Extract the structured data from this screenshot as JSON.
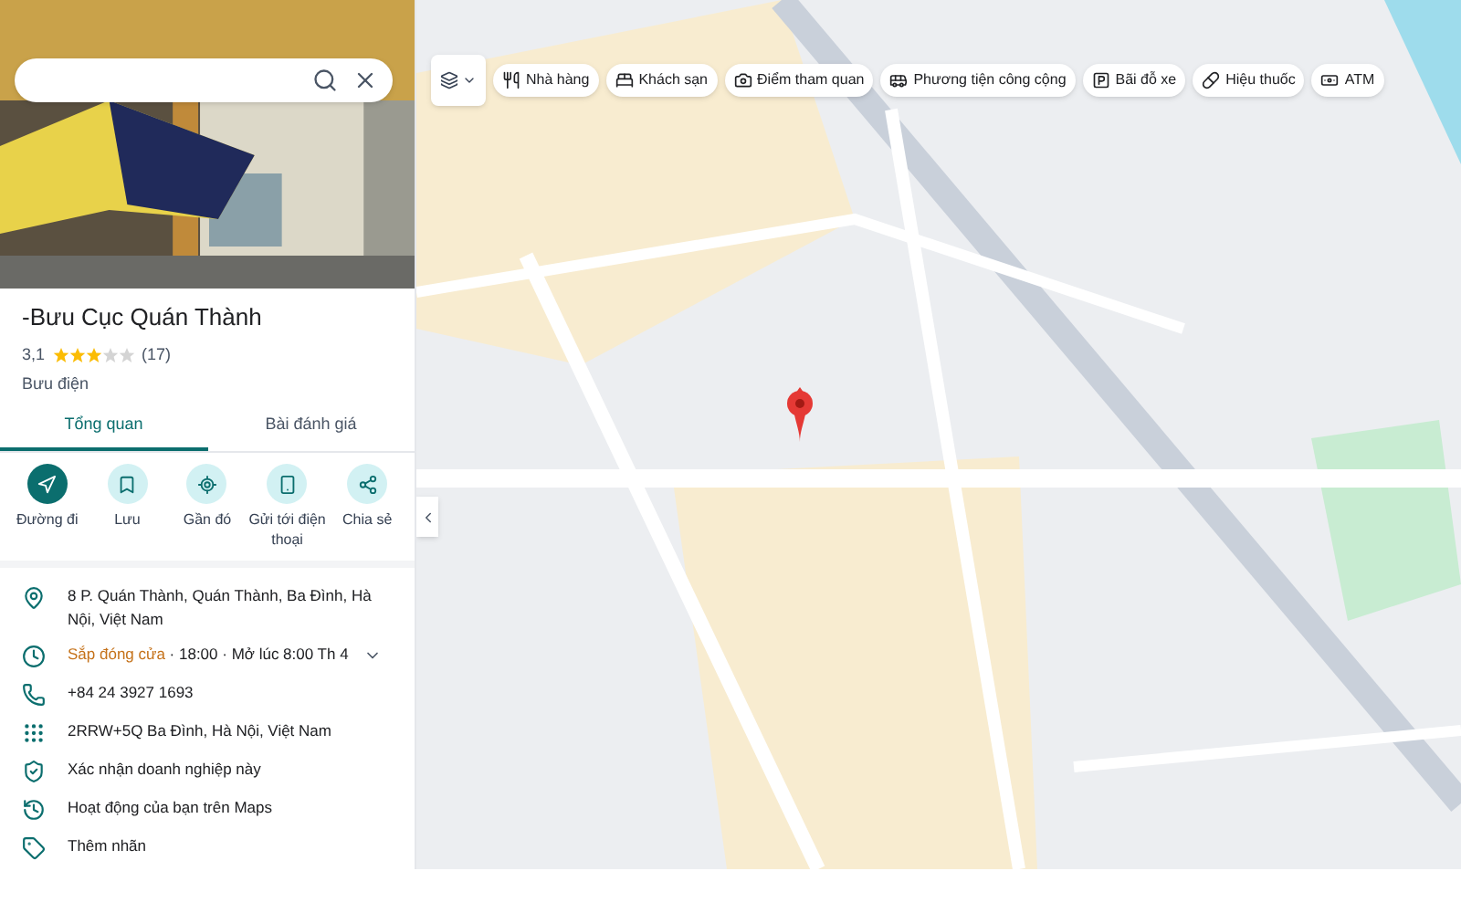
{
  "place": {
    "name": "-Bưu Cục Quán Thành",
    "rating": "3,1",
    "stars": 3,
    "reviews": "(17)",
    "category": "Bưu điện"
  },
  "tabs": [
    {
      "label": "Tổng quan",
      "selected": true
    },
    {
      "label": "Bài đánh giá",
      "selected": false
    }
  ],
  "actions": [
    {
      "label": "Đường đi",
      "kind": "primary"
    },
    {
      "label": "Lưu",
      "kind": "secondary"
    },
    {
      "label": "Gần đó",
      "kind": "secondary"
    },
    {
      "label": "Gửi tới điện thoại",
      "kind": "secondary"
    },
    {
      "label": "Chia sẻ",
      "kind": "secondary"
    }
  ],
  "details": [
    {
      "kind": "address",
      "text": "8 P. Quán Thành, Quán Thành, Ba Đình, Hà Nội, Việt Nam"
    },
    {
      "kind": "hours",
      "status": "Sắp đóng cửa",
      "text": " · 18:00 · Mở lúc 8:00 Th 4",
      "expanded": false
    },
    {
      "kind": "phone",
      "text": "+84 24 3927 1693"
    },
    {
      "kind": "pluscode",
      "text": "2RRW+5Q Ba Đình, Hà Nội, Việt Nam"
    },
    {
      "kind": "claim",
      "text": "Xác nhận doanh nghiệp này"
    },
    {
      "kind": "activity",
      "text": "Hoạt động của bạn trên Maps"
    },
    {
      "kind": "label",
      "text": "Thêm nhãn"
    }
  ],
  "chips": [
    {
      "label": "Nhà hàng"
    },
    {
      "label": "Khách sạn"
    },
    {
      "label": "Điểm tham quan"
    },
    {
      "label": "Phương tiện công cộng"
    },
    {
      "label": "Bãi đỗ xe"
    },
    {
      "label": "Hiệu thuốc"
    },
    {
      "label": "ATM"
    }
  ]
}
